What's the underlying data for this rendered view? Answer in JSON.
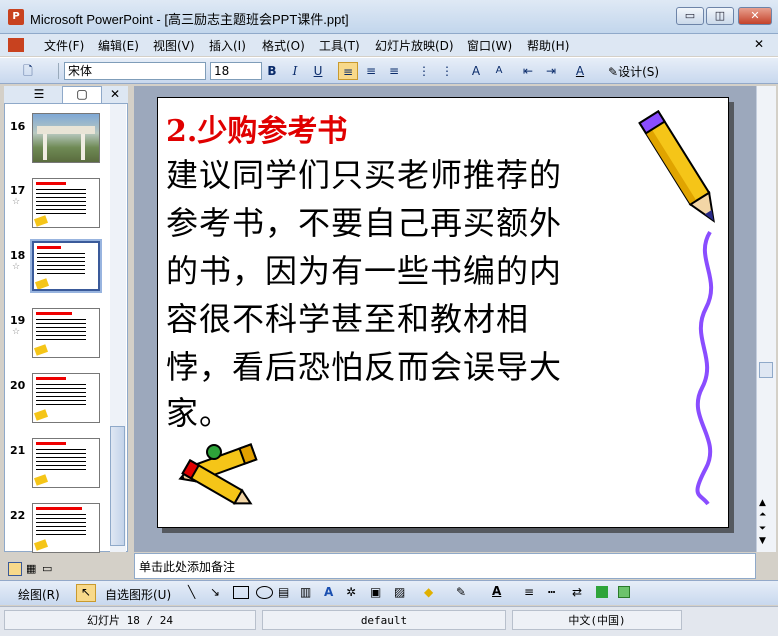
{
  "window": {
    "title": "Microsoft PowerPoint - [高三励志主题班会PPT课件.ppt]",
    "app_icon": "P",
    "minimize_glyph": "▭",
    "maximize_glyph": "◫",
    "close_glyph": "✕"
  },
  "menu": {
    "items": [
      "文件(F)",
      "编辑(E)",
      "视图(V)",
      "插入(I)",
      "格式(O)",
      "工具(T)",
      "幻灯片放映(D)",
      "窗口(W)",
      "帮助(H)"
    ],
    "doc_close": "✕"
  },
  "toolbar": {
    "font_name": "宋体",
    "font_size": "18",
    "bold": "B",
    "italic": "I",
    "underline": "U",
    "font_color_label": "A",
    "design_label": "设计(S)"
  },
  "slides_panel": {
    "thumbnails": [
      {
        "number": "16"
      },
      {
        "number": "17"
      },
      {
        "number": "18"
      },
      {
        "number": "19"
      },
      {
        "number": "20"
      },
      {
        "number": "21"
      },
      {
        "number": "22"
      }
    ],
    "selected": "18"
  },
  "slide": {
    "heading": "2.少购参考书",
    "body_lines": [
      "  建议同学们只买老师推荐的",
      "参考书，不要自己再买额外",
      "的书，因为有一些书编的内",
      "容很不科学甚至和教材相",
      "悖，看后恐怕反而会误导大",
      "家。"
    ]
  },
  "notes": {
    "placeholder": "单击此处添加备注"
  },
  "draw_toolbar": {
    "draw_label": "绘图(R)",
    "autoshapes_label": "自选图形(U)"
  },
  "status": {
    "slide_info": "幻灯片 18 / 24",
    "template": "default",
    "language": "中文(中国)"
  },
  "colors": {
    "heading_red": "#e00000",
    "pencil_yellow": "#f5c518",
    "squiggle_purple": "#8a4dff"
  }
}
